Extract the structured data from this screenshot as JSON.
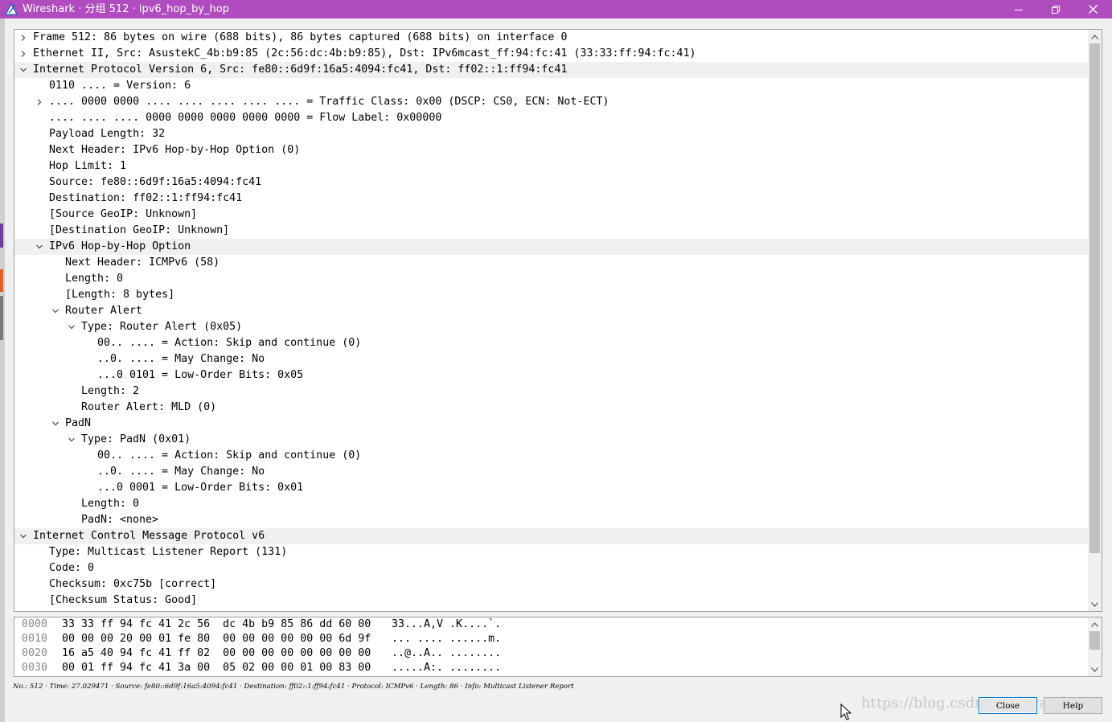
{
  "window": {
    "title": "Wireshark · 分组 512 · ipv6_hop_by_hop",
    "titlebar_color": "#b04cbf",
    "icons": {
      "app": "wireshark-fin-icon",
      "minimize": "minimize-icon",
      "maximize": "restore-icon",
      "close": "close-icon"
    }
  },
  "tree": {
    "rows": [
      {
        "text": "Frame 512: 86 bytes on wire (688 bits), 86 bytes captured (688 bits) on interface 0",
        "level": 0,
        "expander": "collapsed"
      },
      {
        "text": "Ethernet II, Src: AsustekC_4b:b9:85 (2c:56:dc:4b:b9:85), Dst: IPv6mcast_ff:94:fc:41 (33:33:ff:94:fc:41)",
        "level": 0,
        "expander": "collapsed"
      },
      {
        "text": "Internet Protocol Version 6, Src: fe80::6d9f:16a5:4094:fc41, Dst: ff02::1:ff94:fc41",
        "level": 0,
        "expander": "expanded",
        "highlight": true
      },
      {
        "text": "0110 .... = Version: 6",
        "level": 1,
        "expander": "none"
      },
      {
        "text": ".... 0000 0000 .... .... .... .... .... = Traffic Class: 0x00 (DSCP: CS0, ECN: Not-ECT)",
        "level": 1,
        "expander": "collapsed"
      },
      {
        "text": ".... .... .... 0000 0000 0000 0000 0000 = Flow Label: 0x00000",
        "level": 1,
        "expander": "none"
      },
      {
        "text": "Payload Length: 32",
        "level": 1,
        "expander": "none"
      },
      {
        "text": "Next Header: IPv6 Hop-by-Hop Option (0)",
        "level": 1,
        "expander": "none"
      },
      {
        "text": "Hop Limit: 1",
        "level": 1,
        "expander": "none"
      },
      {
        "text": "Source: fe80::6d9f:16a5:4094:fc41",
        "level": 1,
        "expander": "none"
      },
      {
        "text": "Destination: ff02::1:ff94:fc41",
        "level": 1,
        "expander": "none"
      },
      {
        "text": "[Source GeoIP: Unknown]",
        "level": 1,
        "expander": "none"
      },
      {
        "text": "[Destination GeoIP: Unknown]",
        "level": 1,
        "expander": "none"
      },
      {
        "text": "IPv6 Hop-by-Hop Option",
        "level": 1,
        "expander": "expanded",
        "highlight": true
      },
      {
        "text": "Next Header: ICMPv6 (58)",
        "level": 2,
        "expander": "none"
      },
      {
        "text": "Length: 0",
        "level": 2,
        "expander": "none"
      },
      {
        "text": "[Length: 8 bytes]",
        "level": 2,
        "expander": "none"
      },
      {
        "text": "Router Alert",
        "level": 2,
        "expander": "expanded"
      },
      {
        "text": "Type: Router Alert (0x05)",
        "level": 3,
        "expander": "expanded"
      },
      {
        "text": "00.. .... = Action: Skip and continue (0)",
        "level": 4,
        "expander": "none"
      },
      {
        "text": "..0. .... = May Change: No",
        "level": 4,
        "expander": "none"
      },
      {
        "text": "...0 0101 = Low-Order Bits: 0x05",
        "level": 4,
        "expander": "none"
      },
      {
        "text": "Length: 2",
        "level": 3,
        "expander": "none"
      },
      {
        "text": "Router Alert: MLD (0)",
        "level": 3,
        "expander": "none"
      },
      {
        "text": "PadN",
        "level": 2,
        "expander": "expanded"
      },
      {
        "text": "Type: PadN (0x01)",
        "level": 3,
        "expander": "expanded"
      },
      {
        "text": "00.. .... = Action: Skip and continue (0)",
        "level": 4,
        "expander": "none"
      },
      {
        "text": "..0. .... = May Change: No",
        "level": 4,
        "expander": "none"
      },
      {
        "text": "...0 0001 = Low-Order Bits: 0x01",
        "level": 4,
        "expander": "none"
      },
      {
        "text": "Length: 0",
        "level": 3,
        "expander": "none"
      },
      {
        "text": "PadN: <none>",
        "level": 3,
        "expander": "none"
      },
      {
        "text": "Internet Control Message Protocol v6",
        "level": 0,
        "expander": "expanded",
        "highlight": true
      },
      {
        "text": "Type: Multicast Listener Report (131)",
        "level": 1,
        "expander": "none"
      },
      {
        "text": "Code: 0",
        "level": 1,
        "expander": "none"
      },
      {
        "text": "Checksum: 0xc75b [correct]",
        "level": 1,
        "expander": "none"
      },
      {
        "text": "[Checksum Status: Good]",
        "level": 1,
        "expander": "none"
      }
    ],
    "scroll_position": 0.0,
    "visible_fraction": 0.92
  },
  "hex": {
    "rows": [
      {
        "offset": "0000",
        "bytes": "33 33 ff 94 fc 41 2c 56  dc 4b b9 85 86 dd 60 00",
        "ascii": "33...A,V .K....`."
      },
      {
        "offset": "0010",
        "bytes": "00 00 00 20 00 01 fe 80  00 00 00 00 00 00 6d 9f",
        "ascii": "... .... ......m."
      },
      {
        "offset": "0020",
        "bytes": "16 a5 40 94 fc 41 ff 02  00 00 00 00 00 00 00 00",
        "ascii": "..@..A.. ........"
      },
      {
        "offset": "0030",
        "bytes": "00 01 ff 94 fc 41 3a 00  05 02 00 00 01 00 83 00",
        "ascii": ".....A:. ........"
      }
    ],
    "scroll_position": 0.0,
    "visible_fraction": 0.6
  },
  "status": {
    "text": "No.: 512 · Time: 27.029471 · Source: fe80::6d9f:16a5:4094:fc41 · Destination: ff02::1:ff94:fc41 · Protocol: ICMPv6 · Length: 86 · Info: Multicast Listener Report"
  },
  "buttons": {
    "close_label": "Close",
    "help_label": "Help"
  },
  "watermark": "https://blog.csdn.net/luyande"
}
